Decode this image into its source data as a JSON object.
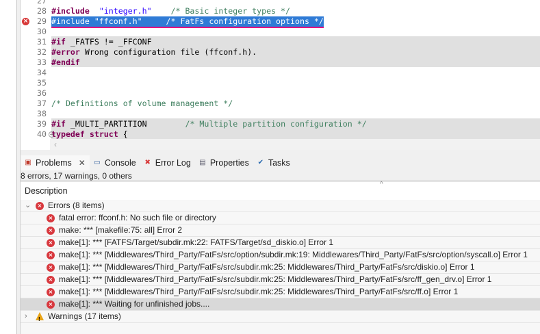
{
  "editor": {
    "lines": [
      {
        "n": "27",
        "parts": []
      },
      {
        "n": "28",
        "parts": [
          [
            "kw",
            "#include"
          ],
          [
            "",
            "  "
          ],
          [
            "str",
            "\"integer.h\""
          ],
          [
            "",
            "    "
          ],
          [
            "cm",
            "/* Basic integer types */"
          ]
        ]
      },
      {
        "n": "29",
        "parts": [
          [
            "",
            "#include \"ffconf.h\"     /* FatFs configuration options */"
          ]
        ],
        "selected": true,
        "error": true
      },
      {
        "n": "30",
        "parts": []
      },
      {
        "n": "31",
        "parts": [
          [
            "kw",
            "#if"
          ],
          [
            "",
            " _FATFS != _FFCONF"
          ]
        ],
        "gray": true
      },
      {
        "n": "32",
        "parts": [
          [
            "kw",
            "#error"
          ],
          [
            "",
            " Wrong configuration file (ffconf.h)."
          ]
        ],
        "gray": true
      },
      {
        "n": "33",
        "parts": [
          [
            "kw",
            "#endif"
          ]
        ],
        "gray": true
      },
      {
        "n": "34",
        "parts": []
      },
      {
        "n": "35",
        "parts": []
      },
      {
        "n": "36",
        "parts": []
      },
      {
        "n": "37",
        "parts": [
          [
            "cm",
            "/* Definitions of volume management */"
          ]
        ]
      },
      {
        "n": "38",
        "parts": []
      },
      {
        "n": "39",
        "parts": [
          [
            "kw",
            "#if"
          ],
          [
            "",
            " _MULTI_PARTITION        "
          ],
          [
            "cm",
            "/* Multiple partition configuration */"
          ]
        ],
        "gray": true
      },
      {
        "n": "40",
        "parts": [
          [
            "kw",
            "typedef"
          ],
          [
            "",
            " "
          ],
          [
            "kw",
            "struct"
          ],
          [
            "",
            " {"
          ]
        ],
        "gray": true,
        "fold": true
      }
    ]
  },
  "tabs": [
    {
      "label": "Problems",
      "icon": "problems-icon",
      "active": true
    },
    {
      "label": "Console",
      "icon": "console-icon"
    },
    {
      "label": "Error Log",
      "icon": "error-log-icon"
    },
    {
      "label": "Properties",
      "icon": "properties-icon"
    },
    {
      "label": "Tasks",
      "icon": "tasks-icon"
    }
  ],
  "status": "8 errors, 17 warnings, 0 others",
  "columns": {
    "description": "Description"
  },
  "errors_group": "Errors (8 items)",
  "errors": [
    "fatal error: ffconf.h: No such file or directory",
    "make: *** [makefile:75: all] Error 2",
    "make[1]: *** [FATFS/Target/subdir.mk:22: FATFS/Target/sd_diskio.o] Error 1",
    "make[1]: *** [Middlewares/Third_Party/FatFs/src/option/subdir.mk:19: Middlewares/Third_Party/FatFs/src/option/syscall.o] Error 1",
    "make[1]: *** [Middlewares/Third_Party/FatFs/src/subdir.mk:25: Middlewares/Third_Party/FatFs/src/diskio.o] Error 1",
    "make[1]: *** [Middlewares/Third_Party/FatFs/src/subdir.mk:25: Middlewares/Third_Party/FatFs/src/ff_gen_drv.o] Error 1",
    "make[1]: *** [Middlewares/Third_Party/FatFs/src/subdir.mk:25: Middlewares/Third_Party/FatFs/src/ff.o] Error 1",
    "make[1]: *** Waiting for unfinished jobs...."
  ],
  "warnings_group": "Warnings (17 items)"
}
